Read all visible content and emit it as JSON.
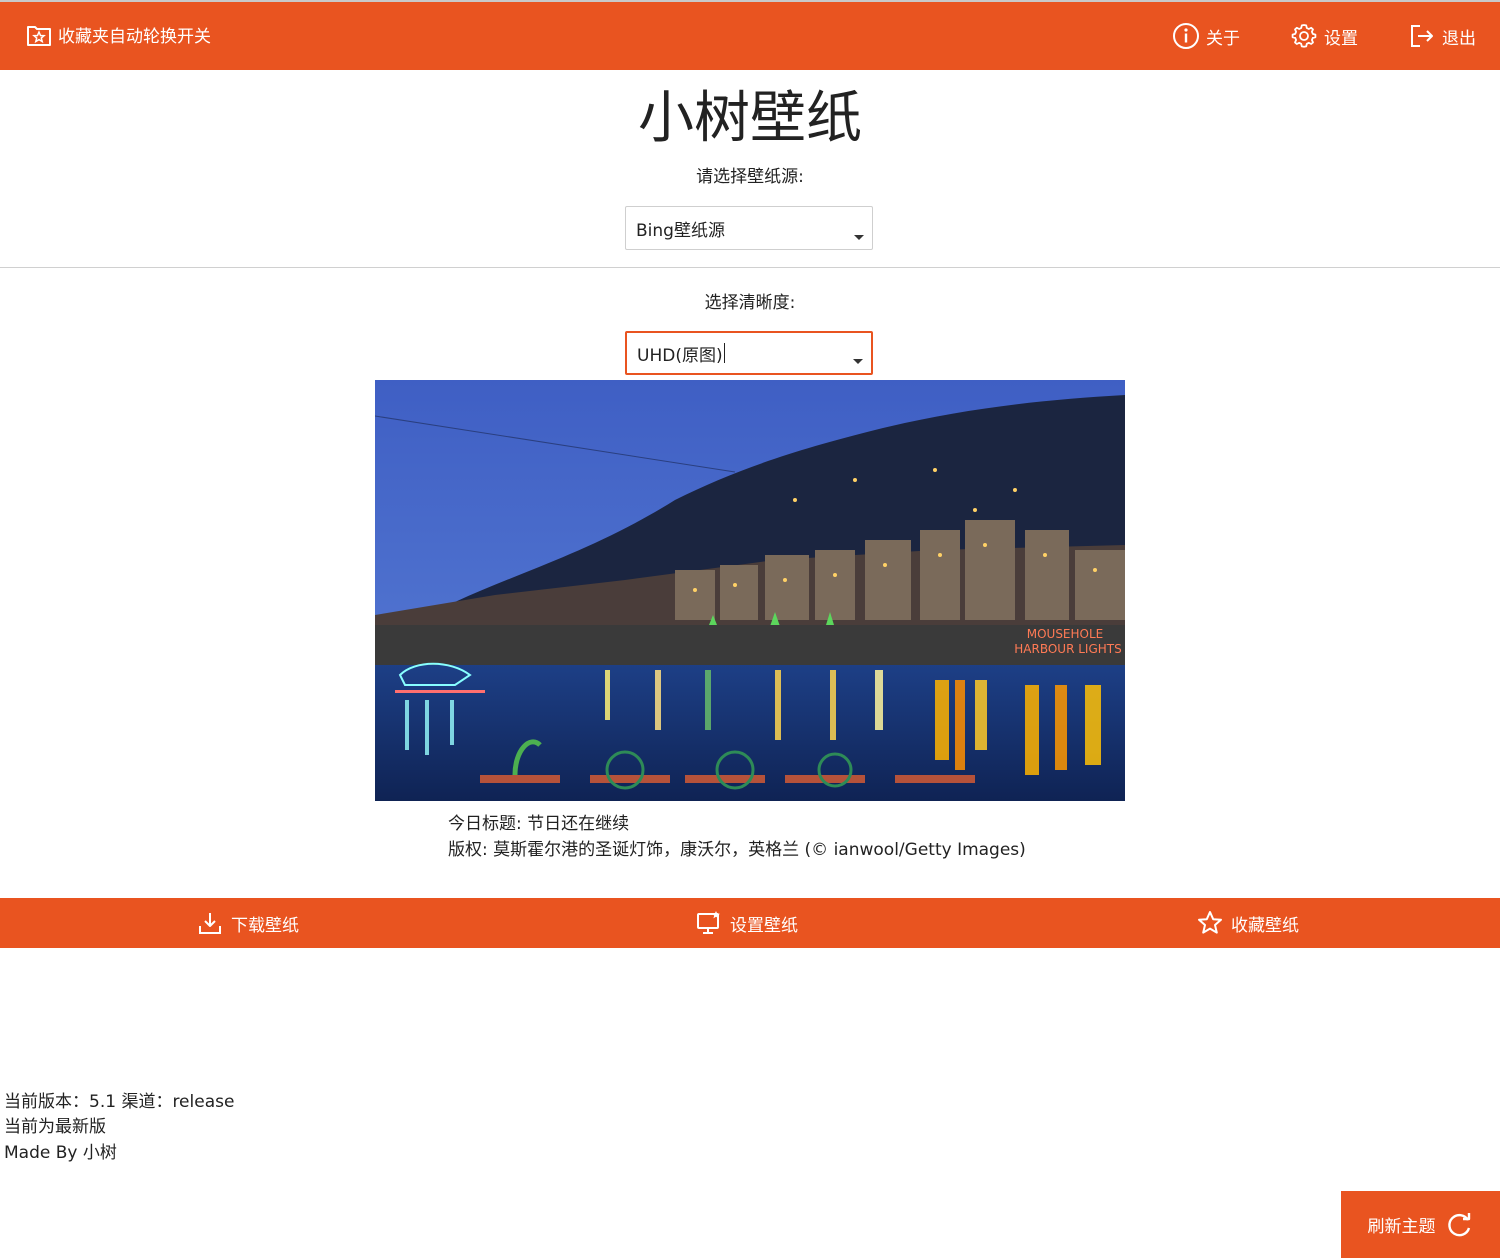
{
  "topbar": {
    "left_label": "收藏夹自动轮换开关",
    "about_label": "关于",
    "settings_label": "设置",
    "exit_label": "退出"
  },
  "app_title": "小树壁纸",
  "source": {
    "label": "请选择壁纸源:",
    "selected": "Bing壁纸源"
  },
  "quality": {
    "label": "选择清晰度:",
    "selected": "UHD(原图)"
  },
  "wallpaper": {
    "title_line": "今日标题: 节日还在继续",
    "copyright_line": "版权: 莫斯霍尔港的圣诞灯饰，康沃尔，英格兰 (© ianwool/Getty Images)",
    "sign_text_1": "MOUSEHOLE",
    "sign_text_2": "HARBOUR LIGHTS"
  },
  "actions": {
    "download_label": "下载壁纸",
    "set_label": "设置壁纸",
    "favorite_label": "收藏壁纸"
  },
  "footer": {
    "version_line": "当前版本：5.1 渠道：release",
    "update_line": "当前为最新版",
    "credit_line": "Made By 小树"
  },
  "refresh_label": "刷新主题",
  "colors": {
    "accent": "#E95420"
  }
}
